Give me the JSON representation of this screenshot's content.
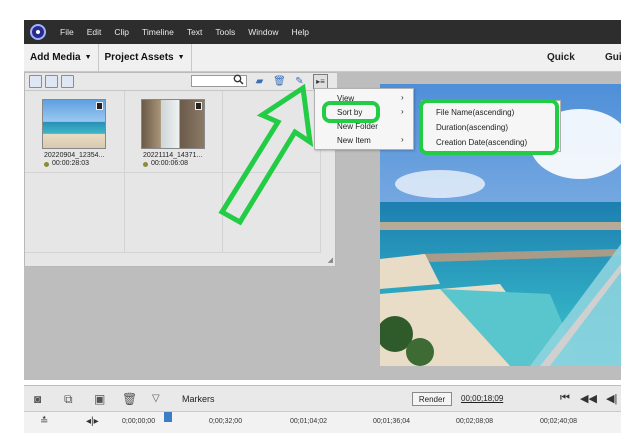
{
  "menubar": {
    "items": [
      "File",
      "Edit",
      "Clip",
      "Timeline",
      "Text",
      "Tools",
      "Window",
      "Help"
    ]
  },
  "header": {
    "add_media": "Add Media",
    "project_assets": "Project Assets",
    "mode_quick": "Quick",
    "mode_guided": "Gui"
  },
  "assets": [
    {
      "name": "20220904_12354...",
      "duration": "00:00:28:03"
    },
    {
      "name": "20221114_14371...",
      "duration": "00:00:06:08"
    }
  ],
  "context_menu": {
    "items": [
      {
        "label": "View",
        "has_submenu": true
      },
      {
        "label": "Sort by",
        "has_submenu": true
      },
      {
        "label": "New Folder",
        "has_submenu": false
      },
      {
        "label": "New Item",
        "has_submenu": true
      }
    ],
    "arrow": "›"
  },
  "sort_submenu": {
    "items": [
      "File Name(ascending)",
      "Duration(ascending)",
      "Creation Date(ascending)"
    ]
  },
  "bottombar": {
    "markers_label": "Markers",
    "render_label": "Render",
    "timecode": "00;00;18;09"
  },
  "ruler": {
    "ticks": [
      "0;00;00;00",
      "0;00;32;00",
      "00;01;04;02",
      "00;01;36;04",
      "00;02;08;08",
      "00;02;40;08"
    ]
  },
  "colors": {
    "highlight": "#22cc44",
    "menubar": "#2d2d2d"
  }
}
